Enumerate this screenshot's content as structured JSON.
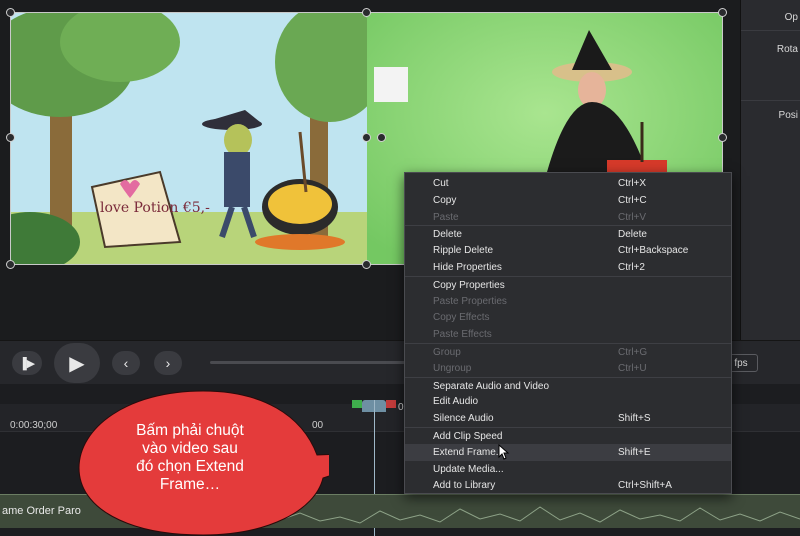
{
  "canvas": {
    "left_clip": {
      "sign_text": "love Potion €5,-"
    }
  },
  "properties_panel": {
    "labels": [
      "Op",
      "Rota",
      "Posi"
    ]
  },
  "playback": {
    "fps_label": "fps"
  },
  "timeline": {
    "time_label_1": "0:00:30;00",
    "time_label_2": "00",
    "time_label_3": "0",
    "clip_name": "ame Order Paro"
  },
  "context_menu": {
    "items": [
      {
        "label": "Cut",
        "shortcut": "Ctrl+X",
        "enabled": true
      },
      {
        "label": "Copy",
        "shortcut": "Ctrl+C",
        "enabled": true
      },
      {
        "label": "Paste",
        "shortcut": "Ctrl+V",
        "enabled": false
      },
      {
        "label": "Delete",
        "shortcut": "Delete",
        "enabled": true
      },
      {
        "label": "Ripple Delete",
        "shortcut": "Ctrl+Backspace",
        "enabled": true
      },
      {
        "label": "Hide Properties",
        "shortcut": "Ctrl+2",
        "enabled": true
      },
      {
        "label": "Copy Properties",
        "shortcut": "",
        "enabled": true
      },
      {
        "label": "Paste Properties",
        "shortcut": "",
        "enabled": false
      },
      {
        "label": "Copy Effects",
        "shortcut": "",
        "enabled": false
      },
      {
        "label": "Paste Effects",
        "shortcut": "",
        "enabled": false
      },
      {
        "label": "Group",
        "shortcut": "Ctrl+G",
        "enabled": false
      },
      {
        "label": "Ungroup",
        "shortcut": "Ctrl+U",
        "enabled": false
      },
      {
        "label": "Separate Audio and Video",
        "shortcut": "",
        "enabled": true
      },
      {
        "label": "Edit Audio",
        "shortcut": "",
        "enabled": true
      },
      {
        "label": "Silence Audio",
        "shortcut": "Shift+S",
        "enabled": true
      },
      {
        "label": "Add Clip Speed",
        "shortcut": "",
        "enabled": true
      },
      {
        "label": "Extend Frame...",
        "shortcut": "Shift+E",
        "enabled": true,
        "highlighted": true
      },
      {
        "label": "Update Media...",
        "shortcut": "",
        "enabled": true
      },
      {
        "label": "Add to Library",
        "shortcut": "Ctrl+Shift+A",
        "enabled": true
      }
    ]
  },
  "callout": {
    "text_line_1": "Bấm phải chuột",
    "text_line_2": "vào video sau",
    "text_line_3": "đó chọn Extend",
    "text_line_4": "Frame…",
    "color": "#e43b3b"
  }
}
